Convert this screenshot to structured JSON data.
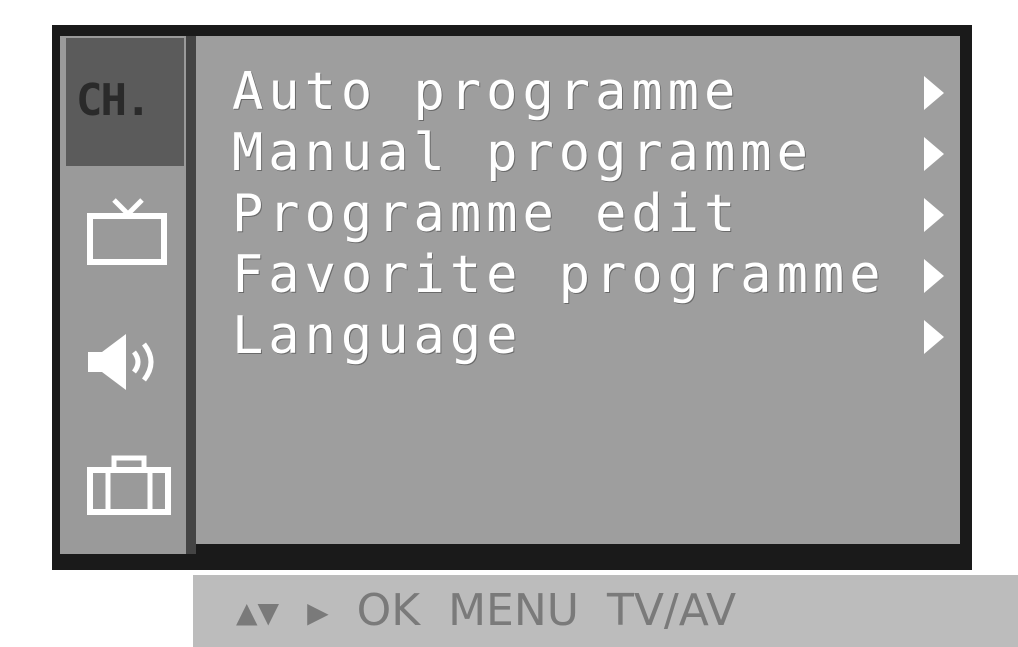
{
  "sidebar": {
    "active_label": "CH.",
    "icons": [
      "tv-icon",
      "speaker-icon",
      "toolbox-icon"
    ]
  },
  "menu": {
    "items": [
      {
        "label": "Auto programme"
      },
      {
        "label": "Manual programme"
      },
      {
        "label": "Programme edit"
      },
      {
        "label": "Favorite programme"
      },
      {
        "label": "Language"
      }
    ]
  },
  "bottom_bar": {
    "arrows_hint": "▲▼",
    "right_hint": "▶",
    "ok_label": "OK",
    "menu_label": "MENU",
    "tvav_label": "TV/AV"
  },
  "colors": {
    "panel": "#9e9e9e",
    "sidebar": "#9a9a9a",
    "active_tab": "#5b5b5b",
    "border": "#1a1a1a",
    "text": "#ffffff",
    "hint_bar": "#bcbcbc"
  }
}
